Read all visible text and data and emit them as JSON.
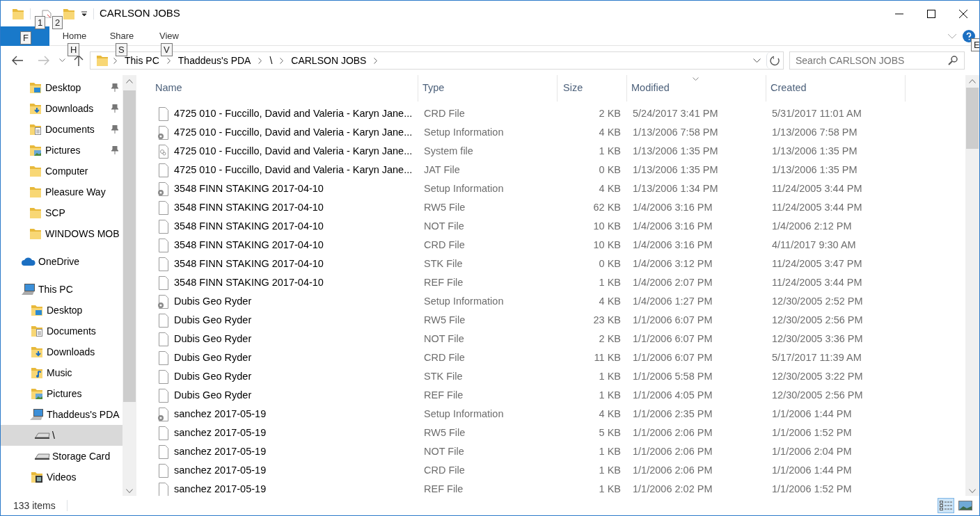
{
  "window": {
    "title": "CARLSON JOBS"
  },
  "key_tips": [
    "1",
    "2",
    "F",
    "H",
    "S",
    "V",
    "E"
  ],
  "ribbon_tabs": [
    {
      "label": "Home",
      "selected": false
    },
    {
      "label": "Share",
      "selected": false
    },
    {
      "label": "View",
      "selected": false
    }
  ],
  "breadcrumb": [
    "This PC",
    "Thaddeus's PDA",
    "\\",
    "CARLSON JOBS"
  ],
  "search": {
    "placeholder": "Search CARLSON JOBS"
  },
  "sidebar": {
    "quick_access": [
      {
        "label": "Desktop",
        "kind": "desktop",
        "pinned": true,
        "selected": false
      },
      {
        "label": "Downloads",
        "kind": "downloads",
        "pinned": true,
        "selected": false
      },
      {
        "label": "Documents",
        "kind": "documents",
        "pinned": true,
        "selected": false
      },
      {
        "label": "Pictures",
        "kind": "pictures",
        "pinned": true,
        "selected": false
      },
      {
        "label": "Computer",
        "kind": "folder",
        "pinned": false,
        "selected": false
      },
      {
        "label": "Pleasure Way",
        "kind": "folder",
        "pinned": false,
        "selected": false
      },
      {
        "label": "SCP",
        "kind": "folder",
        "pinned": false,
        "selected": false
      },
      {
        "label": "WINDOWS MOB",
        "kind": "folder",
        "pinned": false,
        "selected": false
      }
    ],
    "tree": [
      {
        "label": "OneDrive",
        "kind": "cloud",
        "selected": false
      },
      {
        "label": "This PC",
        "kind": "pc",
        "selected": false,
        "children": [
          {
            "label": "Desktop",
            "kind": "desktop",
            "selected": false
          },
          {
            "label": "Documents",
            "kind": "documents",
            "selected": false
          },
          {
            "label": "Downloads",
            "kind": "downloads",
            "selected": false
          },
          {
            "label": "Music",
            "kind": "music",
            "selected": false
          },
          {
            "label": "Pictures",
            "kind": "pictures",
            "selected": false
          },
          {
            "label": "Thaddeus's PDA",
            "kind": "device",
            "selected": false,
            "children": [
              {
                "label": "\\",
                "kind": "drive",
                "selected": true
              },
              {
                "label": "Storage Card",
                "kind": "drive",
                "selected": false
              }
            ]
          },
          {
            "label": "Videos",
            "kind": "videos",
            "selected": false
          }
        ]
      }
    ]
  },
  "table": {
    "columns": [
      {
        "label": "Name",
        "sorted": false
      },
      {
        "label": "Type",
        "sorted": false
      },
      {
        "label": "Size",
        "sorted": false
      },
      {
        "label": "Modified",
        "sorted": true
      },
      {
        "label": "Created",
        "sorted": false
      }
    ],
    "rows": [
      {
        "kind": "blank",
        "name": "4725 010 - Fuccillo, David and Valeria - Karyn Jane...",
        "type": "CRD File",
        "size": "2 KB",
        "modified": "5/24/2017 3:41 PM",
        "created": "5/31/2017 11:01 AM"
      },
      {
        "kind": "setup",
        "name": "4725 010 - Fuccillo, David and Valeria - Karyn Jane...",
        "type": "Setup Information",
        "size": "4 KB",
        "modified": "1/13/2006 7:58 PM",
        "created": "1/13/2006 7:58 PM"
      },
      {
        "kind": "system",
        "name": "4725 010 - Fuccillo, David and Valeria - Karyn Jane...",
        "type": "System file",
        "size": "1 KB",
        "modified": "1/13/2006 1:35 PM",
        "created": "1/13/2006 1:35 PM"
      },
      {
        "kind": "blank",
        "name": "4725 010 - Fuccillo, David and Valeria - Karyn Jane...",
        "type": "JAT File",
        "size": "0 KB",
        "modified": "1/13/2006 1:35 PM",
        "created": "1/13/2006 1:35 PM"
      },
      {
        "kind": "setup",
        "name": "3548 FINN STAKING 2017-04-10",
        "type": "Setup Information",
        "size": "4 KB",
        "modified": "1/13/2006 1:34 PM",
        "created": "11/24/2005 3:44 PM"
      },
      {
        "kind": "blank",
        "name": "3548 FINN STAKING 2017-04-10",
        "type": "RW5 File",
        "size": "62 KB",
        "modified": "1/4/2006 3:16 PM",
        "created": "11/24/2005 3:44 PM"
      },
      {
        "kind": "blank",
        "name": "3548 FINN STAKING 2017-04-10",
        "type": "NOT File",
        "size": "10 KB",
        "modified": "1/4/2006 3:16 PM",
        "created": "1/4/2006 2:12 PM"
      },
      {
        "kind": "blank",
        "name": "3548 FINN STAKING 2017-04-10",
        "type": "CRD File",
        "size": "10 KB",
        "modified": "1/4/2006 3:16 PM",
        "created": "4/11/2017 9:30 AM"
      },
      {
        "kind": "blank",
        "name": "3548 FINN STAKING 2017-04-10",
        "type": "STK File",
        "size": "0 KB",
        "modified": "1/4/2006 3:12 PM",
        "created": "11/24/2005 3:47 PM"
      },
      {
        "kind": "blank",
        "name": "3548 FINN STAKING 2017-04-10",
        "type": "REF File",
        "size": "1 KB",
        "modified": "1/4/2006 2:07 PM",
        "created": "11/24/2005 3:44 PM"
      },
      {
        "kind": "setup",
        "name": "Dubis Geo Ryder",
        "type": "Setup Information",
        "size": "4 KB",
        "modified": "1/4/2006 1:27 PM",
        "created": "12/30/2005 2:52 PM"
      },
      {
        "kind": "blank",
        "name": "Dubis Geo Ryder",
        "type": "RW5 File",
        "size": "23 KB",
        "modified": "1/1/2006 6:07 PM",
        "created": "12/30/2005 2:56 PM"
      },
      {
        "kind": "blank",
        "name": "Dubis Geo Ryder",
        "type": "NOT File",
        "size": "2 KB",
        "modified": "1/1/2006 6:07 PM",
        "created": "12/30/2005 3:36 PM"
      },
      {
        "kind": "blank",
        "name": "Dubis Geo Ryder",
        "type": "CRD File",
        "size": "11 KB",
        "modified": "1/1/2006 6:07 PM",
        "created": "5/17/2017 11:39 AM"
      },
      {
        "kind": "blank",
        "name": "Dubis Geo Ryder",
        "type": "STK File",
        "size": "1 KB",
        "modified": "1/1/2006 5:58 PM",
        "created": "12/30/2005 3:22 PM"
      },
      {
        "kind": "blank",
        "name": "Dubis Geo Ryder",
        "type": "REF File",
        "size": "1 KB",
        "modified": "1/1/2006 4:05 PM",
        "created": "12/30/2005 2:56 PM"
      },
      {
        "kind": "setup",
        "name": "sanchez 2017-05-19",
        "type": "Setup Information",
        "size": "4 KB",
        "modified": "1/1/2006 2:35 PM",
        "created": "1/1/2006 1:44 PM"
      },
      {
        "kind": "blank",
        "name": "sanchez 2017-05-19",
        "type": "RW5 File",
        "size": "5 KB",
        "modified": "1/1/2006 2:06 PM",
        "created": "1/1/2006 1:52 PM"
      },
      {
        "kind": "blank",
        "name": "sanchez 2017-05-19",
        "type": "NOT File",
        "size": "1 KB",
        "modified": "1/1/2006 2:06 PM",
        "created": "1/1/2006 2:04 PM"
      },
      {
        "kind": "blank",
        "name": "sanchez 2017-05-19",
        "type": "CRD File",
        "size": "1 KB",
        "modified": "1/1/2006 2:06 PM",
        "created": "1/1/2006 1:44 PM"
      },
      {
        "kind": "blank",
        "name": "sanchez 2017-05-19",
        "type": "REF File",
        "size": "1 KB",
        "modified": "1/1/2006 2:02 PM",
        "created": "1/1/2006 1:52 PM"
      }
    ]
  },
  "status_bar": {
    "item_count": "133 items"
  },
  "view_buttons": [
    {
      "kind": "details",
      "selected": true
    },
    {
      "kind": "thumbnails",
      "selected": false
    }
  ]
}
